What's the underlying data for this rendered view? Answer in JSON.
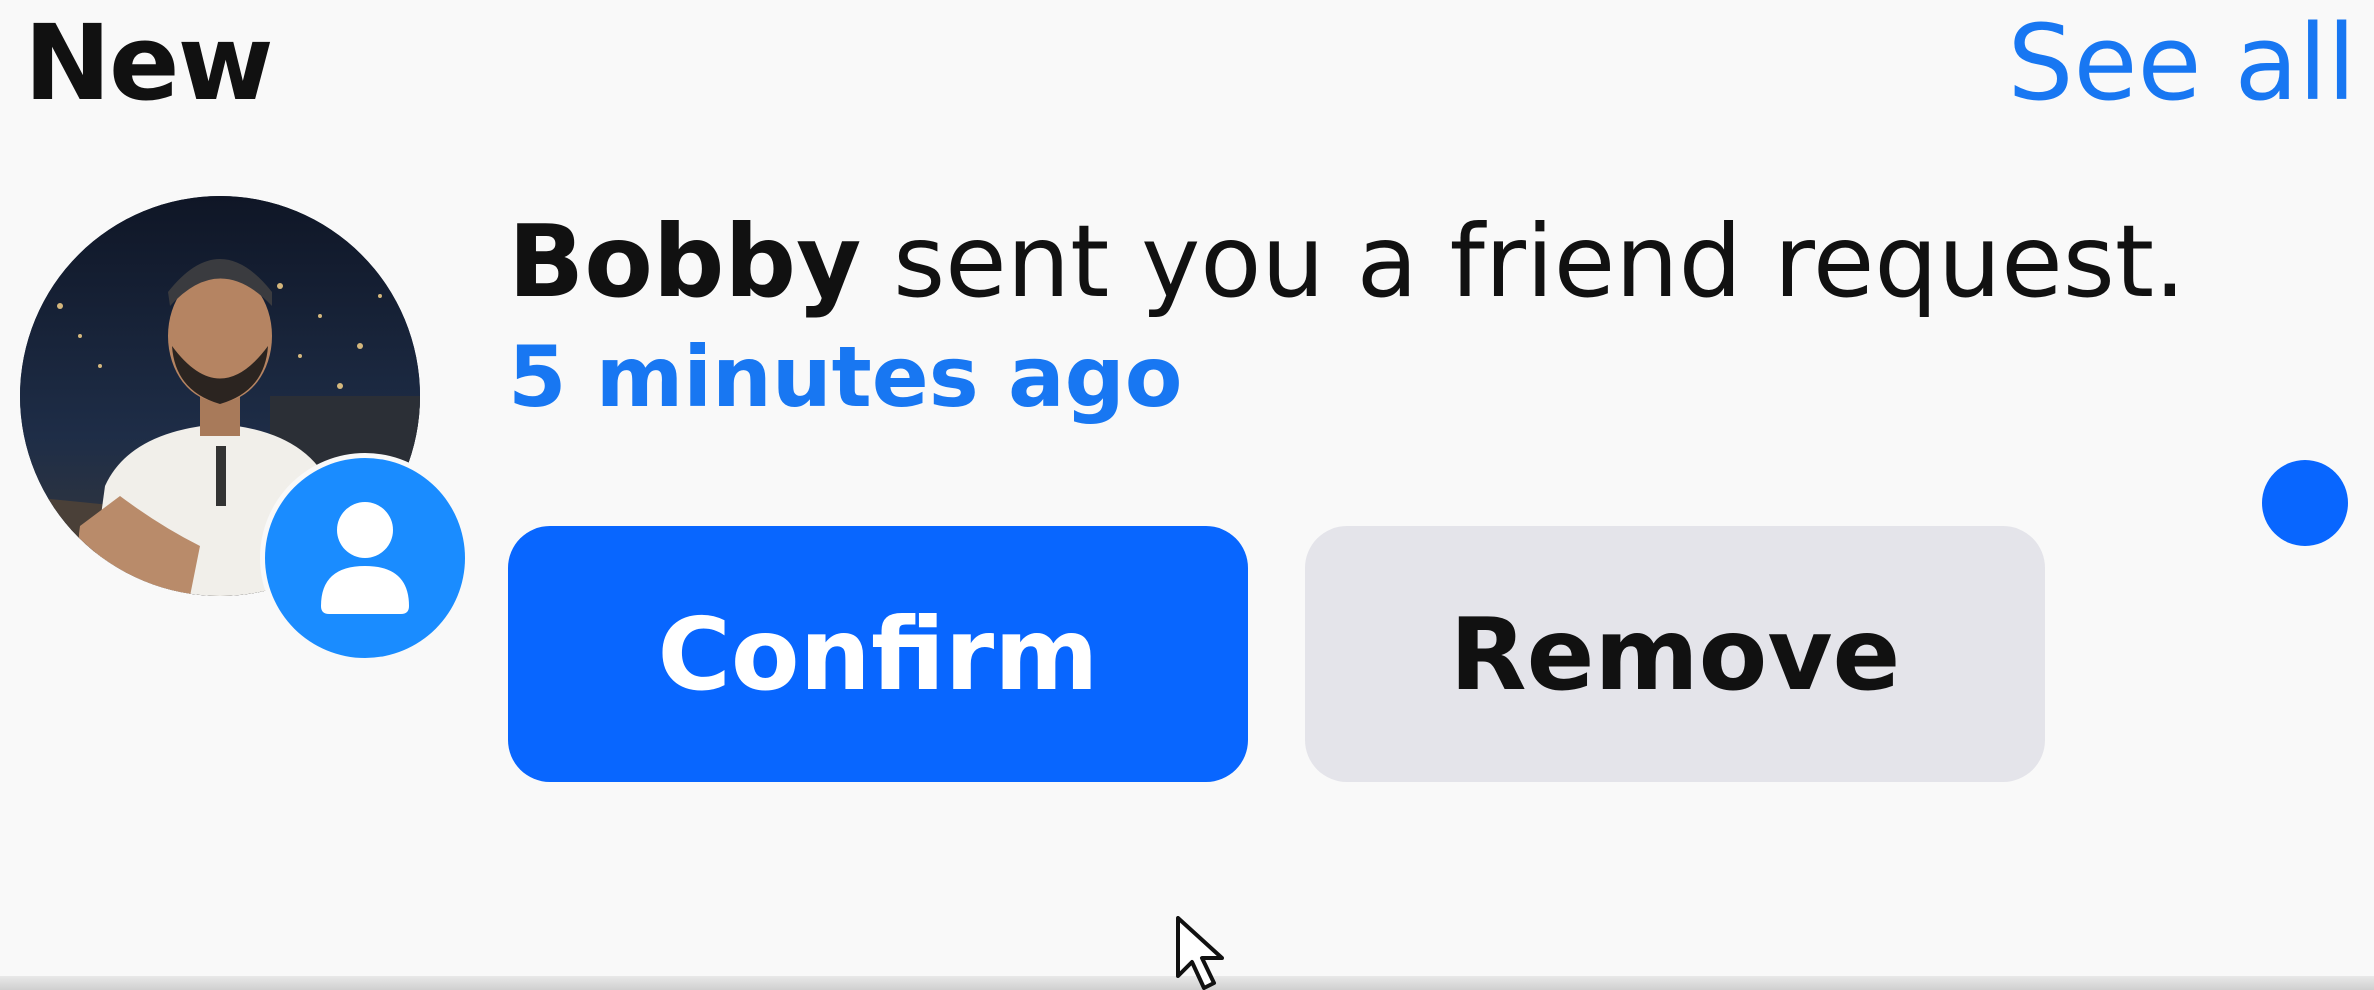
{
  "header": {
    "title": "New",
    "see_all_label": "See all"
  },
  "notification": {
    "actor_name": "Bobby",
    "message_rest": " sent you a friend request.",
    "timestamp": "5 minutes ago",
    "badge_icon": "person-icon",
    "confirm_label": "Confirm",
    "remove_label": "Remove",
    "unread": true
  },
  "colors": {
    "accent": "#0866ff",
    "link": "#1877f2",
    "secondary_button": "#e4e4ea",
    "background": "#f9f9f9"
  }
}
